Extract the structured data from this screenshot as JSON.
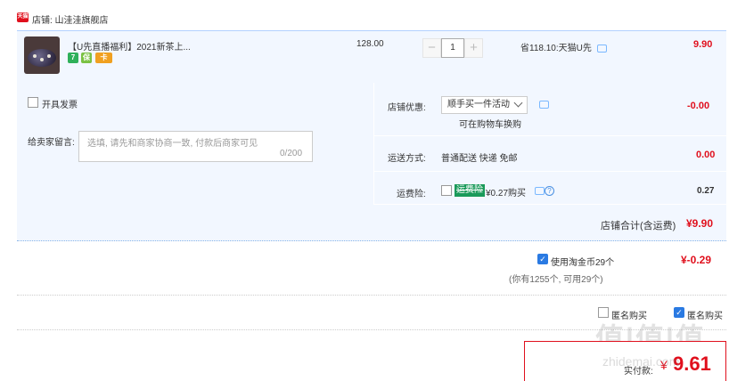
{
  "shop": {
    "icon_text": "天猫",
    "label": "店铺: 山洼洼旗舰店"
  },
  "item": {
    "title": "【U先直播福利】2021新茶上...",
    "badges": [
      "7",
      "保",
      "卡"
    ],
    "unit_price": "128.00",
    "quantity": "1",
    "qty_minus": "−",
    "qty_plus": "+",
    "saving": "省118.10:天猫U先",
    "subtotal": "9.90"
  },
  "options": {
    "invoice_label": "开具发票",
    "message_label": "给卖家留言:",
    "message_placeholder": "选填, 请先和商家协商一致, 付款后商家可见",
    "message_count": "0/200",
    "promo_label": "店铺优惠:",
    "promo_select": "顺手买一件活动",
    "promo_note": "可在购物车换购",
    "promo_value": "-0.00",
    "shipping_label": "运送方式:",
    "shipping_value": "普通配送 快递 免邮",
    "shipping_price": "0.00",
    "insurance_label": "运费险:",
    "insurance_tag": "运费险",
    "insurance_price": "¥0.27购买",
    "insurance_help": "?",
    "insurance_value": "0.27",
    "store_total_label": "店铺合计(含运费)",
    "store_total_value": "¥9.90"
  },
  "coins": {
    "checkmark": "✓",
    "label": "使用淘金币29个",
    "value": "¥-0.29",
    "note": "(你有1255个, 可用29个)"
  },
  "extra": {
    "anonymous_label": "匿名购买",
    "send_label": "匿名购买"
  },
  "payment": {
    "label": "实付款:",
    "currency": "¥",
    "value": "9.61"
  },
  "watermark": {
    "logo": "值|值|值",
    "text": "zhidemai.com"
  }
}
